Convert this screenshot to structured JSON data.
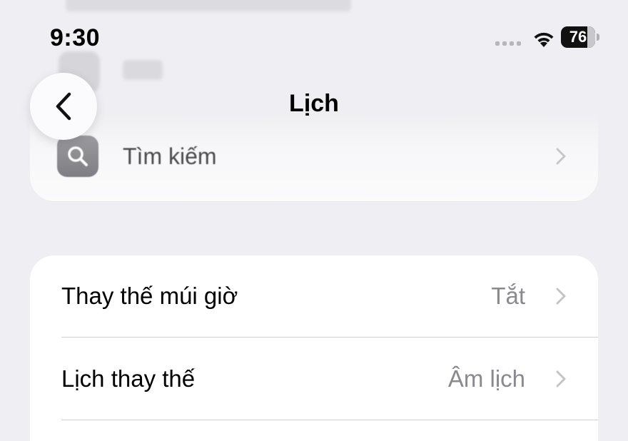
{
  "status_bar": {
    "time": "9:30",
    "battery": "76"
  },
  "nav": {
    "title": "Lịch"
  },
  "search_group": {
    "label": "Tìm kiếm"
  },
  "settings": {
    "rows": [
      {
        "label": "Thay thế múi giờ",
        "value": "Tắt"
      },
      {
        "label": "Lịch thay thế",
        "value": "Âm lịch"
      }
    ]
  },
  "colors": {
    "background": "#efeff3",
    "card": "#ffffff",
    "secondary_text": "#8a8a8e"
  }
}
